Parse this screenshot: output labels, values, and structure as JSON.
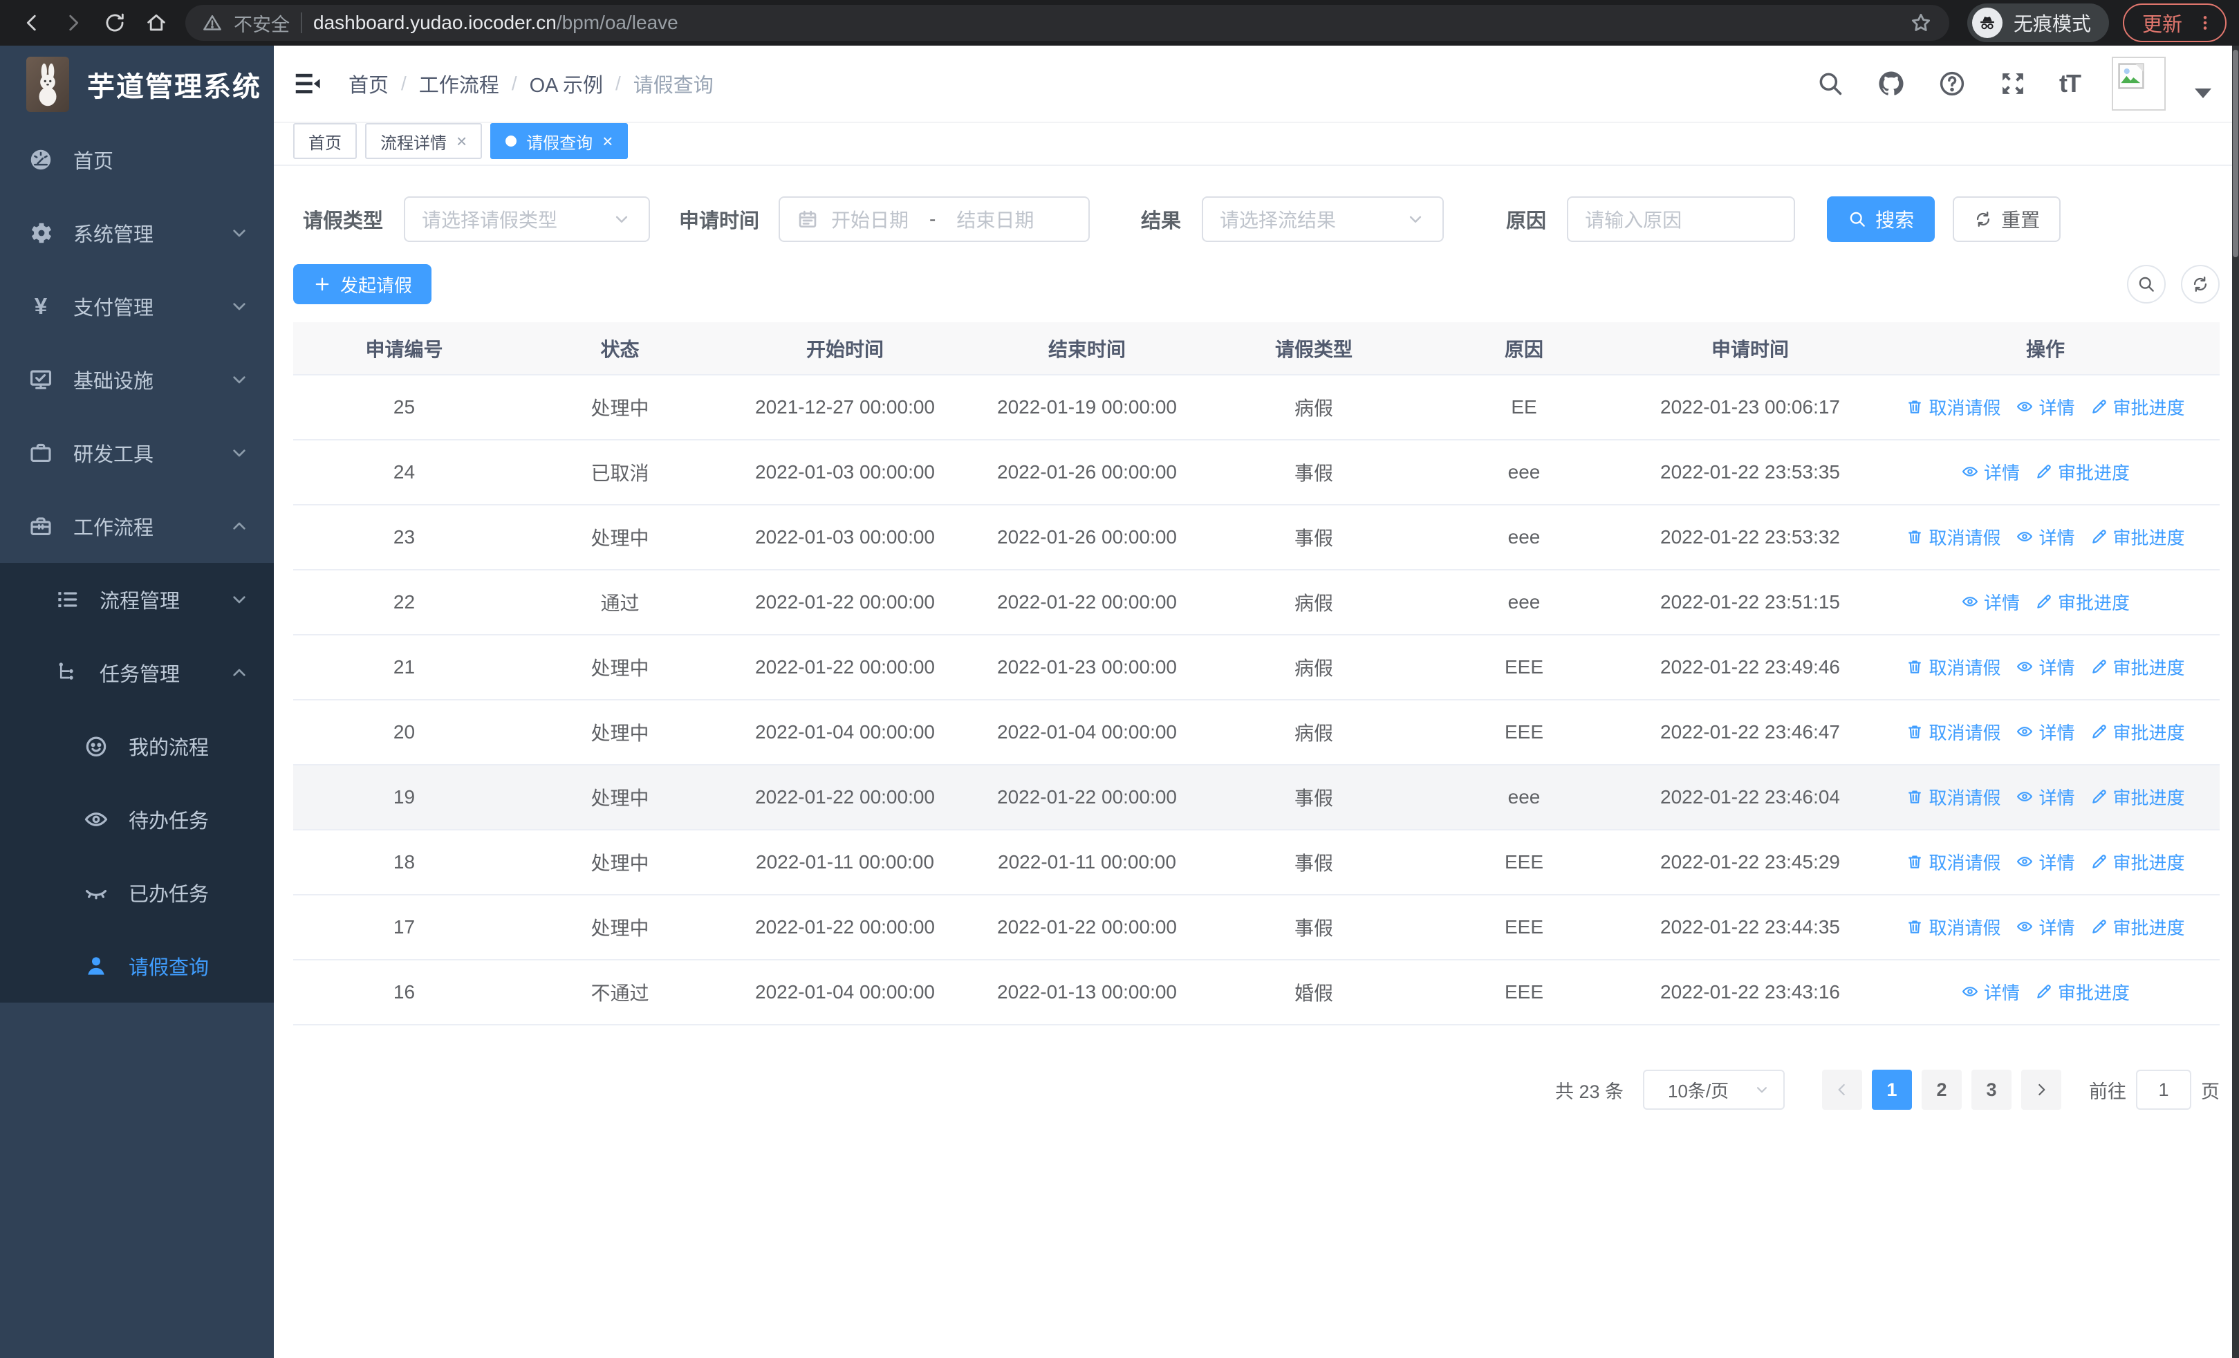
{
  "colors": {
    "accent": "#409eff",
    "sidebar_bg": "#304156",
    "submenu_bg": "#1f2d3d"
  },
  "browser": {
    "security_label": "不安全",
    "url_host": "dashboard.yudao.iocoder.cn",
    "url_path": "/bpm/oa/leave",
    "incognito_label": "无痕模式",
    "update_label": "更新"
  },
  "sidebar": {
    "title": "芋道管理系统",
    "items": [
      {
        "key": "home",
        "label": "首页",
        "icon": "dashboard-icon",
        "level": 0,
        "sub": false,
        "chevron": "",
        "active": false
      },
      {
        "key": "system",
        "label": "系统管理",
        "icon": "gear-icon",
        "level": 0,
        "sub": false,
        "chevron": "down",
        "active": false
      },
      {
        "key": "payment",
        "label": "支付管理",
        "icon": "yen-icon",
        "level": 0,
        "sub": false,
        "chevron": "down",
        "active": false
      },
      {
        "key": "infrastructure",
        "label": "基础设施",
        "icon": "monitor-icon",
        "level": 0,
        "sub": false,
        "chevron": "down",
        "active": false
      },
      {
        "key": "dev-tools",
        "label": "研发工具",
        "icon": "briefcase-icon",
        "level": 0,
        "sub": false,
        "chevron": "down",
        "active": false
      },
      {
        "key": "workflow",
        "label": "工作流程",
        "icon": "toolbox-icon",
        "level": 0,
        "sub": false,
        "chevron": "up",
        "active": false
      },
      {
        "key": "process-mgmt",
        "label": "流程管理",
        "icon": "list-icon",
        "level": 1,
        "sub": true,
        "chevron": "down",
        "active": false
      },
      {
        "key": "task-mgmt",
        "label": "任务管理",
        "icon": "flow-icon",
        "level": 1,
        "sub": true,
        "chevron": "up",
        "active": false
      },
      {
        "key": "my-process",
        "label": "我的流程",
        "icon": "smiley-icon",
        "level": 2,
        "sub": true,
        "chevron": "",
        "active": false
      },
      {
        "key": "todo-tasks",
        "label": "待办任务",
        "icon": "eye-open-icon",
        "level": 2,
        "sub": true,
        "chevron": "",
        "active": false
      },
      {
        "key": "done-tasks",
        "label": "已办任务",
        "icon": "eye-closed-icon",
        "level": 2,
        "sub": true,
        "chevron": "",
        "active": false
      },
      {
        "key": "leave-query",
        "label": "请假查询",
        "icon": "user-icon",
        "level": 2,
        "sub": true,
        "chevron": "",
        "active": true
      }
    ]
  },
  "header": {
    "breadcrumb": [
      "首页",
      "工作流程",
      "OA 示例",
      "请假查询"
    ],
    "font_size_glyph": "tT"
  },
  "tabs": [
    {
      "key": "home",
      "label": "首页",
      "closable": false,
      "active": false
    },
    {
      "key": "process-detail",
      "label": "流程详情",
      "closable": true,
      "active": false
    },
    {
      "key": "leave-query",
      "label": "请假查询",
      "closable": true,
      "active": true
    }
  ],
  "filters": {
    "type_label": "请假类型",
    "type_placeholder": "请选择请假类型",
    "time_label": "申请时间",
    "start_placeholder": "开始日期",
    "range_separator": "-",
    "end_placeholder": "结束日期",
    "result_label": "结果",
    "result_placeholder": "请选择流结果",
    "reason_label": "原因",
    "reason_placeholder": "请输入原因",
    "search_label": "搜索",
    "reset_label": "重置"
  },
  "toolbar": {
    "create_label": "发起请假"
  },
  "table": {
    "columns": [
      "申请编号",
      "状态",
      "开始时间",
      "结束时间",
      "请假类型",
      "原因",
      "申请时间",
      "操作"
    ],
    "action_defs": {
      "cancel": {
        "label": "取消请假",
        "icon": "trash-icon"
      },
      "detail": {
        "label": "详情",
        "icon": "eye-icon"
      },
      "progress": {
        "label": "审批进度",
        "icon": "pen-icon"
      }
    },
    "rows": [
      {
        "id": "25",
        "status": "处理中",
        "start": "2021-12-27 00:00:00",
        "end": "2022-01-19 00:00:00",
        "type": "病假",
        "reason": "EE",
        "applied": "2022-01-23 00:06:17",
        "actions": [
          "cancel",
          "detail",
          "progress"
        ],
        "highlight": false
      },
      {
        "id": "24",
        "status": "已取消",
        "start": "2022-01-03 00:00:00",
        "end": "2022-01-26 00:00:00",
        "type": "事假",
        "reason": "eee",
        "applied": "2022-01-22 23:53:35",
        "actions": [
          "detail",
          "progress"
        ],
        "highlight": false
      },
      {
        "id": "23",
        "status": "处理中",
        "start": "2022-01-03 00:00:00",
        "end": "2022-01-26 00:00:00",
        "type": "事假",
        "reason": "eee",
        "applied": "2022-01-22 23:53:32",
        "actions": [
          "cancel",
          "detail",
          "progress"
        ],
        "highlight": false
      },
      {
        "id": "22",
        "status": "通过",
        "start": "2022-01-22 00:00:00",
        "end": "2022-01-22 00:00:00",
        "type": "病假",
        "reason": "eee",
        "applied": "2022-01-22 23:51:15",
        "actions": [
          "detail",
          "progress"
        ],
        "highlight": false
      },
      {
        "id": "21",
        "status": "处理中",
        "start": "2022-01-22 00:00:00",
        "end": "2022-01-23 00:00:00",
        "type": "病假",
        "reason": "EEE",
        "applied": "2022-01-22 23:49:46",
        "actions": [
          "cancel",
          "detail",
          "progress"
        ],
        "highlight": false
      },
      {
        "id": "20",
        "status": "处理中",
        "start": "2022-01-04 00:00:00",
        "end": "2022-01-04 00:00:00",
        "type": "病假",
        "reason": "EEE",
        "applied": "2022-01-22 23:46:47",
        "actions": [
          "cancel",
          "detail",
          "progress"
        ],
        "highlight": false
      },
      {
        "id": "19",
        "status": "处理中",
        "start": "2022-01-22 00:00:00",
        "end": "2022-01-22 00:00:00",
        "type": "事假",
        "reason": "eee",
        "applied": "2022-01-22 23:46:04",
        "actions": [
          "cancel",
          "detail",
          "progress"
        ],
        "highlight": true
      },
      {
        "id": "18",
        "status": "处理中",
        "start": "2022-01-11 00:00:00",
        "end": "2022-01-11 00:00:00",
        "type": "事假",
        "reason": "EEE",
        "applied": "2022-01-22 23:45:29",
        "actions": [
          "cancel",
          "detail",
          "progress"
        ],
        "highlight": false
      },
      {
        "id": "17",
        "status": "处理中",
        "start": "2022-01-22 00:00:00",
        "end": "2022-01-22 00:00:00",
        "type": "事假",
        "reason": "EEE",
        "applied": "2022-01-22 23:44:35",
        "actions": [
          "cancel",
          "detail",
          "progress"
        ],
        "highlight": false
      },
      {
        "id": "16",
        "status": "不通过",
        "start": "2022-01-04 00:00:00",
        "end": "2022-01-13 00:00:00",
        "type": "婚假",
        "reason": "EEE",
        "applied": "2022-01-22 23:43:16",
        "actions": [
          "detail",
          "progress"
        ],
        "highlight": false
      }
    ]
  },
  "pagination": {
    "total": "共 23 条",
    "page_size": "10条/页",
    "pages": [
      "1",
      "2",
      "3"
    ],
    "current": "1",
    "goto_label": "前往",
    "goto_value": "1",
    "goto_suffix": "页"
  }
}
